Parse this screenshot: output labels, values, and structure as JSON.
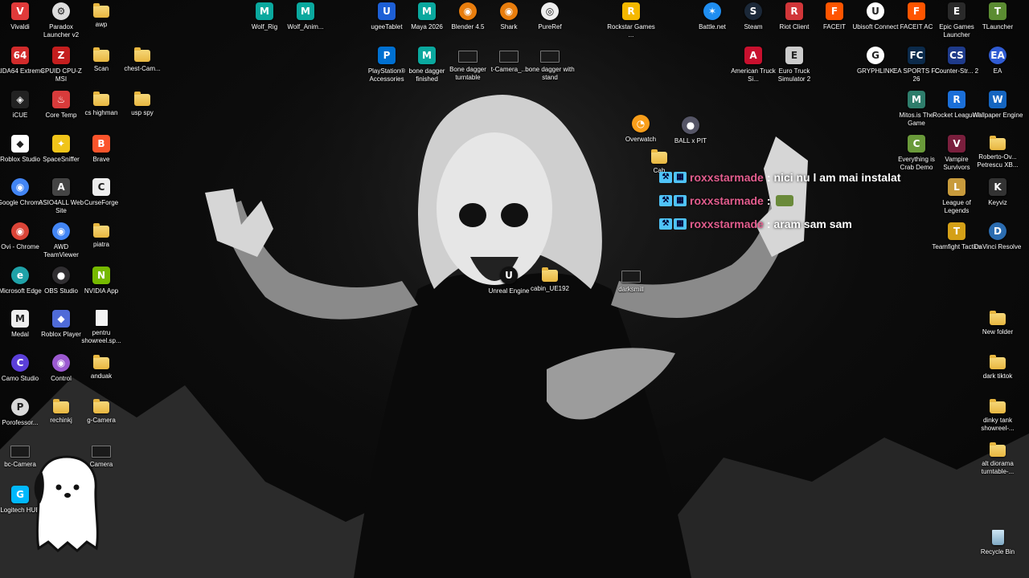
{
  "desktop": {
    "icons": [
      {
        "label": "Vivaldi",
        "icon": "vivaldi-icon",
        "color": "#e03a3a",
        "glyph": "V",
        "shape": "square"
      },
      {
        "label": "Paradox Launcher v2",
        "icon": "paradox-launcher-icon",
        "color": "#dddddd",
        "glyph": "⚙",
        "shape": "circle"
      },
      {
        "label": "awp",
        "icon": "folder-icon",
        "shape": "folder"
      },
      {
        "label": "Wolf_Rig",
        "icon": "maya-file-icon",
        "color": "#0aa89e",
        "glyph": "M",
        "shape": "square"
      },
      {
        "label": "Wolf_Anim...",
        "icon": "maya-file-icon",
        "color": "#0aa89e",
        "glyph": "M",
        "shape": "square"
      },
      {
        "label": "ugeeTablet",
        "icon": "ugee-tablet-icon",
        "color": "#1d5fd6",
        "glyph": "U",
        "shape": "square"
      },
      {
        "label": "Maya 2026",
        "icon": "maya-icon",
        "color": "#0aa89e",
        "glyph": "M",
        "shape": "square"
      },
      {
        "label": "Blender 4.5",
        "icon": "blender-icon",
        "color": "#e87d0d",
        "glyph": "◉",
        "shape": "circle"
      },
      {
        "label": "Shark",
        "icon": "blender-icon",
        "color": "#e87d0d",
        "glyph": "◉",
        "shape": "circle"
      },
      {
        "label": "PureRef",
        "icon": "pureref-icon",
        "color": "#eeeeee",
        "glyph": "◎",
        "shape": "circle"
      },
      {
        "label": "Rockstar Games ...",
        "icon": "rockstar-icon",
        "color": "#f5b800",
        "glyph": "R",
        "shape": "square"
      },
      {
        "label": "Battle.net",
        "icon": "battlenet-icon",
        "color": "#1f8ef1",
        "glyph": "✶",
        "shape": "circle"
      },
      {
        "label": "Steam",
        "icon": "steam-icon",
        "color": "#1b2838",
        "glyph": "S",
        "shape": "circle"
      },
      {
        "label": "Riot Client",
        "icon": "riot-client-icon",
        "color": "#d13639",
        "glyph": "R",
        "shape": "square"
      },
      {
        "label": "FACEIT",
        "icon": "faceit-icon",
        "color": "#ff5500",
        "glyph": "F",
        "shape": "square"
      },
      {
        "label": "Ubisoft Connect",
        "icon": "ubisoft-icon",
        "color": "#ffffff",
        "glyph": "U",
        "shape": "circle"
      },
      {
        "label": "FACEIT AC",
        "icon": "faceit-ac-icon",
        "color": "#ff5500",
        "glyph": "F",
        "shape": "square"
      },
      {
        "label": "Epic Games Launcher",
        "icon": "epic-games-icon",
        "color": "#2a2a2a",
        "glyph": "E",
        "shape": "square"
      },
      {
        "label": "TLauncher",
        "icon": "tlauncher-icon",
        "color": "#5b8c32",
        "glyph": "T",
        "shape": "square"
      },
      {
        "label": "AIDA64 Extreme",
        "icon": "aida64-icon",
        "color": "#d12b2b",
        "glyph": "64",
        "shape": "square"
      },
      {
        "label": "CPUID CPU-Z MSI",
        "icon": "cpuz-icon",
        "color": "#c41e1e",
        "glyph": "Z",
        "shape": "square"
      },
      {
        "label": "Scan",
        "icon": "folder-icon",
        "shape": "folder"
      },
      {
        "label": "chest-Cam...",
        "icon": "folder-icon",
        "shape": "folder"
      },
      {
        "label": "PlayStation® Accessories",
        "icon": "playstation-icon",
        "color": "#0070d1",
        "glyph": "P",
        "shape": "square"
      },
      {
        "label": "bone dagger finished",
        "icon": "maya-file-icon",
        "color": "#0aa89e",
        "glyph": "M",
        "shape": "square"
      },
      {
        "label": "Bone dagger turntable",
        "icon": "video-file-icon",
        "shape": "thumb"
      },
      {
        "label": "t-Camera_...",
        "icon": "video-file-icon",
        "shape": "thumb"
      },
      {
        "label": "bone dagger with stand",
        "icon": "video-file-icon",
        "shape": "thumb"
      },
      {
        "label": "American Truck Si...",
        "icon": "ats-icon",
        "color": "#c8102e",
        "glyph": "A",
        "shape": "square"
      },
      {
        "label": "Euro Truck Simulator 2",
        "icon": "ets2-icon",
        "color": "#cccccc",
        "glyph": "E",
        "shape": "square"
      },
      {
        "label": "GRYPHLINK",
        "icon": "gryphlink-icon",
        "color": "#ffffff",
        "glyph": "G",
        "shape": "circle"
      },
      {
        "label": "EA SPORTS FC 26",
        "icon": "ea-fc-icon",
        "color": "#0b2a4a",
        "glyph": "FC",
        "shape": "square"
      },
      {
        "label": "Counter-Str... 2",
        "icon": "counter-strike-icon",
        "color": "#1e3a8a",
        "glyph": "CS",
        "shape": "square"
      },
      {
        "label": "EA",
        "icon": "ea-icon",
        "color": "#2f5bd3",
        "glyph": "EA",
        "shape": "circle"
      },
      {
        "label": "iCUE",
        "icon": "icue-icon",
        "color": "#222222",
        "glyph": "◈",
        "shape": "square"
      },
      {
        "label": "Core Temp",
        "icon": "core-temp-icon",
        "color": "#d83b3b",
        "glyph": "♨",
        "shape": "square"
      },
      {
        "label": "cs highman",
        "icon": "folder-icon",
        "shape": "folder"
      },
      {
        "label": "usp spy",
        "icon": "folder-icon",
        "shape": "folder"
      },
      {
        "label": "Overwatch",
        "icon": "overwatch-icon",
        "color": "#f99e1a",
        "glyph": "◔",
        "shape": "circle"
      },
      {
        "label": "BALL x PIT",
        "icon": "ball-x-pit-icon",
        "color": "#555566",
        "glyph": "●",
        "shape": "circle"
      },
      {
        "label": "Mitos.is The Game",
        "icon": "mitos-icon",
        "color": "#2e7d6b",
        "glyph": "M",
        "shape": "square"
      },
      {
        "label": "Rocket League®",
        "icon": "rocket-league-icon",
        "color": "#1b6fd8",
        "glyph": "R",
        "shape": "square"
      },
      {
        "label": "Wallpaper Engine",
        "icon": "wallpaper-engine-icon",
        "color": "#1565c0",
        "glyph": "W",
        "shape": "square"
      },
      {
        "label": "Roblox Studio",
        "icon": "roblox-studio-icon",
        "color": "#ffffff",
        "glyph": "◆",
        "shape": "square"
      },
      {
        "label": "SpaceSniffer",
        "icon": "spacesniffer-icon",
        "color": "#f0c419",
        "glyph": "✦",
        "shape": "square"
      },
      {
        "label": "Brave",
        "icon": "brave-icon",
        "color": "#fb542b",
        "glyph": "B",
        "shape": "square"
      },
      {
        "label": "Everything is Crab Demo",
        "icon": "crab-game-icon",
        "color": "#6a9a3a",
        "glyph": "C",
        "shape": "square"
      },
      {
        "label": "Vampire Survivors",
        "icon": "vampire-survivors-icon",
        "color": "#7a1f3d",
        "glyph": "V",
        "shape": "square"
      },
      {
        "label": "Roberto-Ov... Petrescu XB...",
        "icon": "folder-icon",
        "shape": "folder"
      },
      {
        "label": "Cab",
        "icon": "folder-icon",
        "shape": "folder"
      },
      {
        "label": "Google Chrome",
        "icon": "chrome-icon",
        "color": "#4285f4",
        "glyph": "◉",
        "shape": "circle"
      },
      {
        "label": "ASIO4ALL Web Site",
        "icon": "asio4all-icon",
        "color": "#444444",
        "glyph": "A",
        "shape": "square"
      },
      {
        "label": "CurseForge",
        "icon": "curseforge-icon",
        "color": "#eeeeee",
        "glyph": "C",
        "shape": "square"
      },
      {
        "label": "League of Legends",
        "icon": "league-of-legends-icon",
        "color": "#c89b3c",
        "glyph": "L",
        "shape": "square"
      },
      {
        "label": "Keyviz",
        "icon": "keyviz-icon",
        "color": "#333333",
        "glyph": "K",
        "shape": "square"
      },
      {
        "label": "Ovi - Chrome",
        "icon": "chrome-icon",
        "color": "#db4437",
        "glyph": "◉",
        "shape": "circle"
      },
      {
        "label": "AWD TeamViewer",
        "icon": "chrome-icon",
        "color": "#4285f4",
        "glyph": "◉",
        "shape": "circle"
      },
      {
        "label": "piatra",
        "icon": "folder-icon",
        "shape": "folder"
      },
      {
        "label": "Teamfight Tactics",
        "icon": "tft-icon",
        "color": "#d4a017",
        "glyph": "T",
        "shape": "square"
      },
      {
        "label": "DaVinci Resolve",
        "icon": "davinci-icon",
        "color": "#2b6cb0",
        "glyph": "D",
        "shape": "circle"
      },
      {
        "label": "Microsoft Edge",
        "icon": "edge-icon",
        "color": "#1fa2a8",
        "glyph": "e",
        "shape": "circle"
      },
      {
        "label": "OBS Studio",
        "icon": "obs-icon",
        "color": "#302e31",
        "glyph": "●",
        "shape": "circle"
      },
      {
        "label": "NVIDIA App",
        "icon": "nvidia-icon",
        "color": "#76b900",
        "glyph": "N",
        "shape": "square"
      },
      {
        "label": "Unreal Engine",
        "icon": "unreal-engine-icon",
        "color": "#111111",
        "glyph": "U",
        "shape": "circle"
      },
      {
        "label": "cabin_UE192",
        "icon": "folder-icon",
        "shape": "folder"
      },
      {
        "label": "darksmill",
        "icon": "video-file-icon",
        "shape": "thumb"
      },
      {
        "label": "Medal",
        "icon": "medal-icon",
        "color": "#eeeeee",
        "glyph": "M",
        "shape": "square"
      },
      {
        "label": "Roblox Player",
        "icon": "roblox-icon",
        "color": "#4f6bd8",
        "glyph": "◆",
        "shape": "square"
      },
      {
        "label": "pentru showreel.sp...",
        "icon": "document-icon",
        "shape": "doc"
      },
      {
        "label": "New folder",
        "icon": "folder-icon",
        "shape": "folder"
      },
      {
        "label": "Camo Studio",
        "icon": "camo-icon",
        "color": "#5b3fd8",
        "glyph": "C",
        "shape": "circle"
      },
      {
        "label": "Control",
        "icon": "control-icon",
        "color": "#9b59d0",
        "glyph": "◉",
        "shape": "circle"
      },
      {
        "label": "anduak",
        "icon": "folder-icon",
        "shape": "folder"
      },
      {
        "label": "dark tiktok",
        "icon": "folder-icon",
        "shape": "folder"
      },
      {
        "label": "Porofessor...",
        "icon": "porofessor-icon",
        "color": "#d9d9d9",
        "glyph": "P",
        "shape": "circle"
      },
      {
        "label": "rechinkj",
        "icon": "folder-icon",
        "shape": "folder"
      },
      {
        "label": "g-Camera",
        "icon": "folder-icon",
        "shape": "folder"
      },
      {
        "label": "dinky tank showreel-...",
        "icon": "folder-icon",
        "shape": "folder"
      },
      {
        "label": "bc-Camera",
        "icon": "video-file-icon",
        "shape": "thumb"
      },
      {
        "label": "Camera",
        "icon": "video-file-icon",
        "shape": "thumb"
      },
      {
        "label": "alt diorama turntable-...",
        "icon": "folder-icon",
        "shape": "folder"
      },
      {
        "label": "Logitech HUB",
        "icon": "logitech-icon",
        "color": "#00b8fc",
        "glyph": "G",
        "shape": "square"
      },
      {
        "label": "Recycle Bin",
        "icon": "recycle-bin-icon",
        "shape": "bin"
      }
    ]
  },
  "chat": {
    "badge_color": "#4fc3f7",
    "username_color": "#e35d8e",
    "messages": [
      {
        "user": "roxxstarmade",
        "separator": ":",
        "text": "nici nu l am mai instalat"
      },
      {
        "user": "roxxstarmade",
        "separator": ":",
        "text": ""
      },
      {
        "user": "roxxstarmade",
        "separator": ":",
        "text": "aram sam sam"
      }
    ]
  }
}
